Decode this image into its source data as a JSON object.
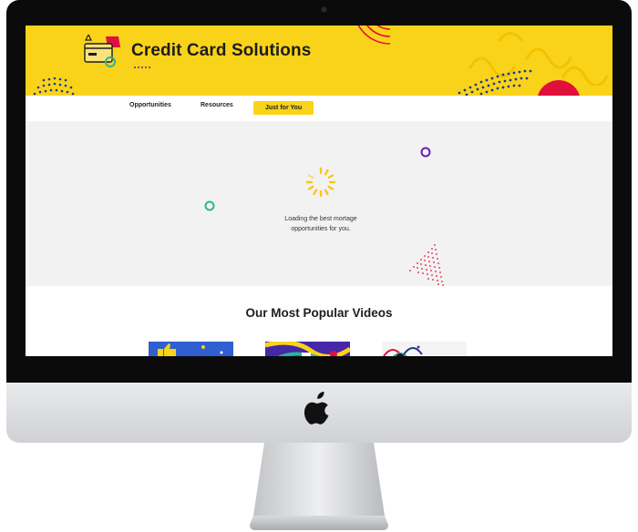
{
  "site": {
    "title": "Credit Card Solutions"
  },
  "nav": {
    "items": [
      {
        "label": "Opportunities"
      },
      {
        "label": "Resources"
      },
      {
        "label": "Just for You"
      }
    ]
  },
  "loading": {
    "line1": "Loading the best mortage",
    "line2": "opportunities for you."
  },
  "videos": {
    "title": "Our Most Popular Videos",
    "thumbnail_count_visible": 3
  },
  "colors": {
    "brand_yellow": "#f9d31a",
    "accent_navy": "#1f3a8a",
    "accent_crimson": "#e0103c",
    "accent_teal": "#2bb39a",
    "accent_purple": "#6a1fb0",
    "accent_pink": "#e44a6a"
  },
  "icons": {
    "brand": "credit-card-icon",
    "spinner": "loading-spinner-icon",
    "device_logo": "apple-logo"
  }
}
